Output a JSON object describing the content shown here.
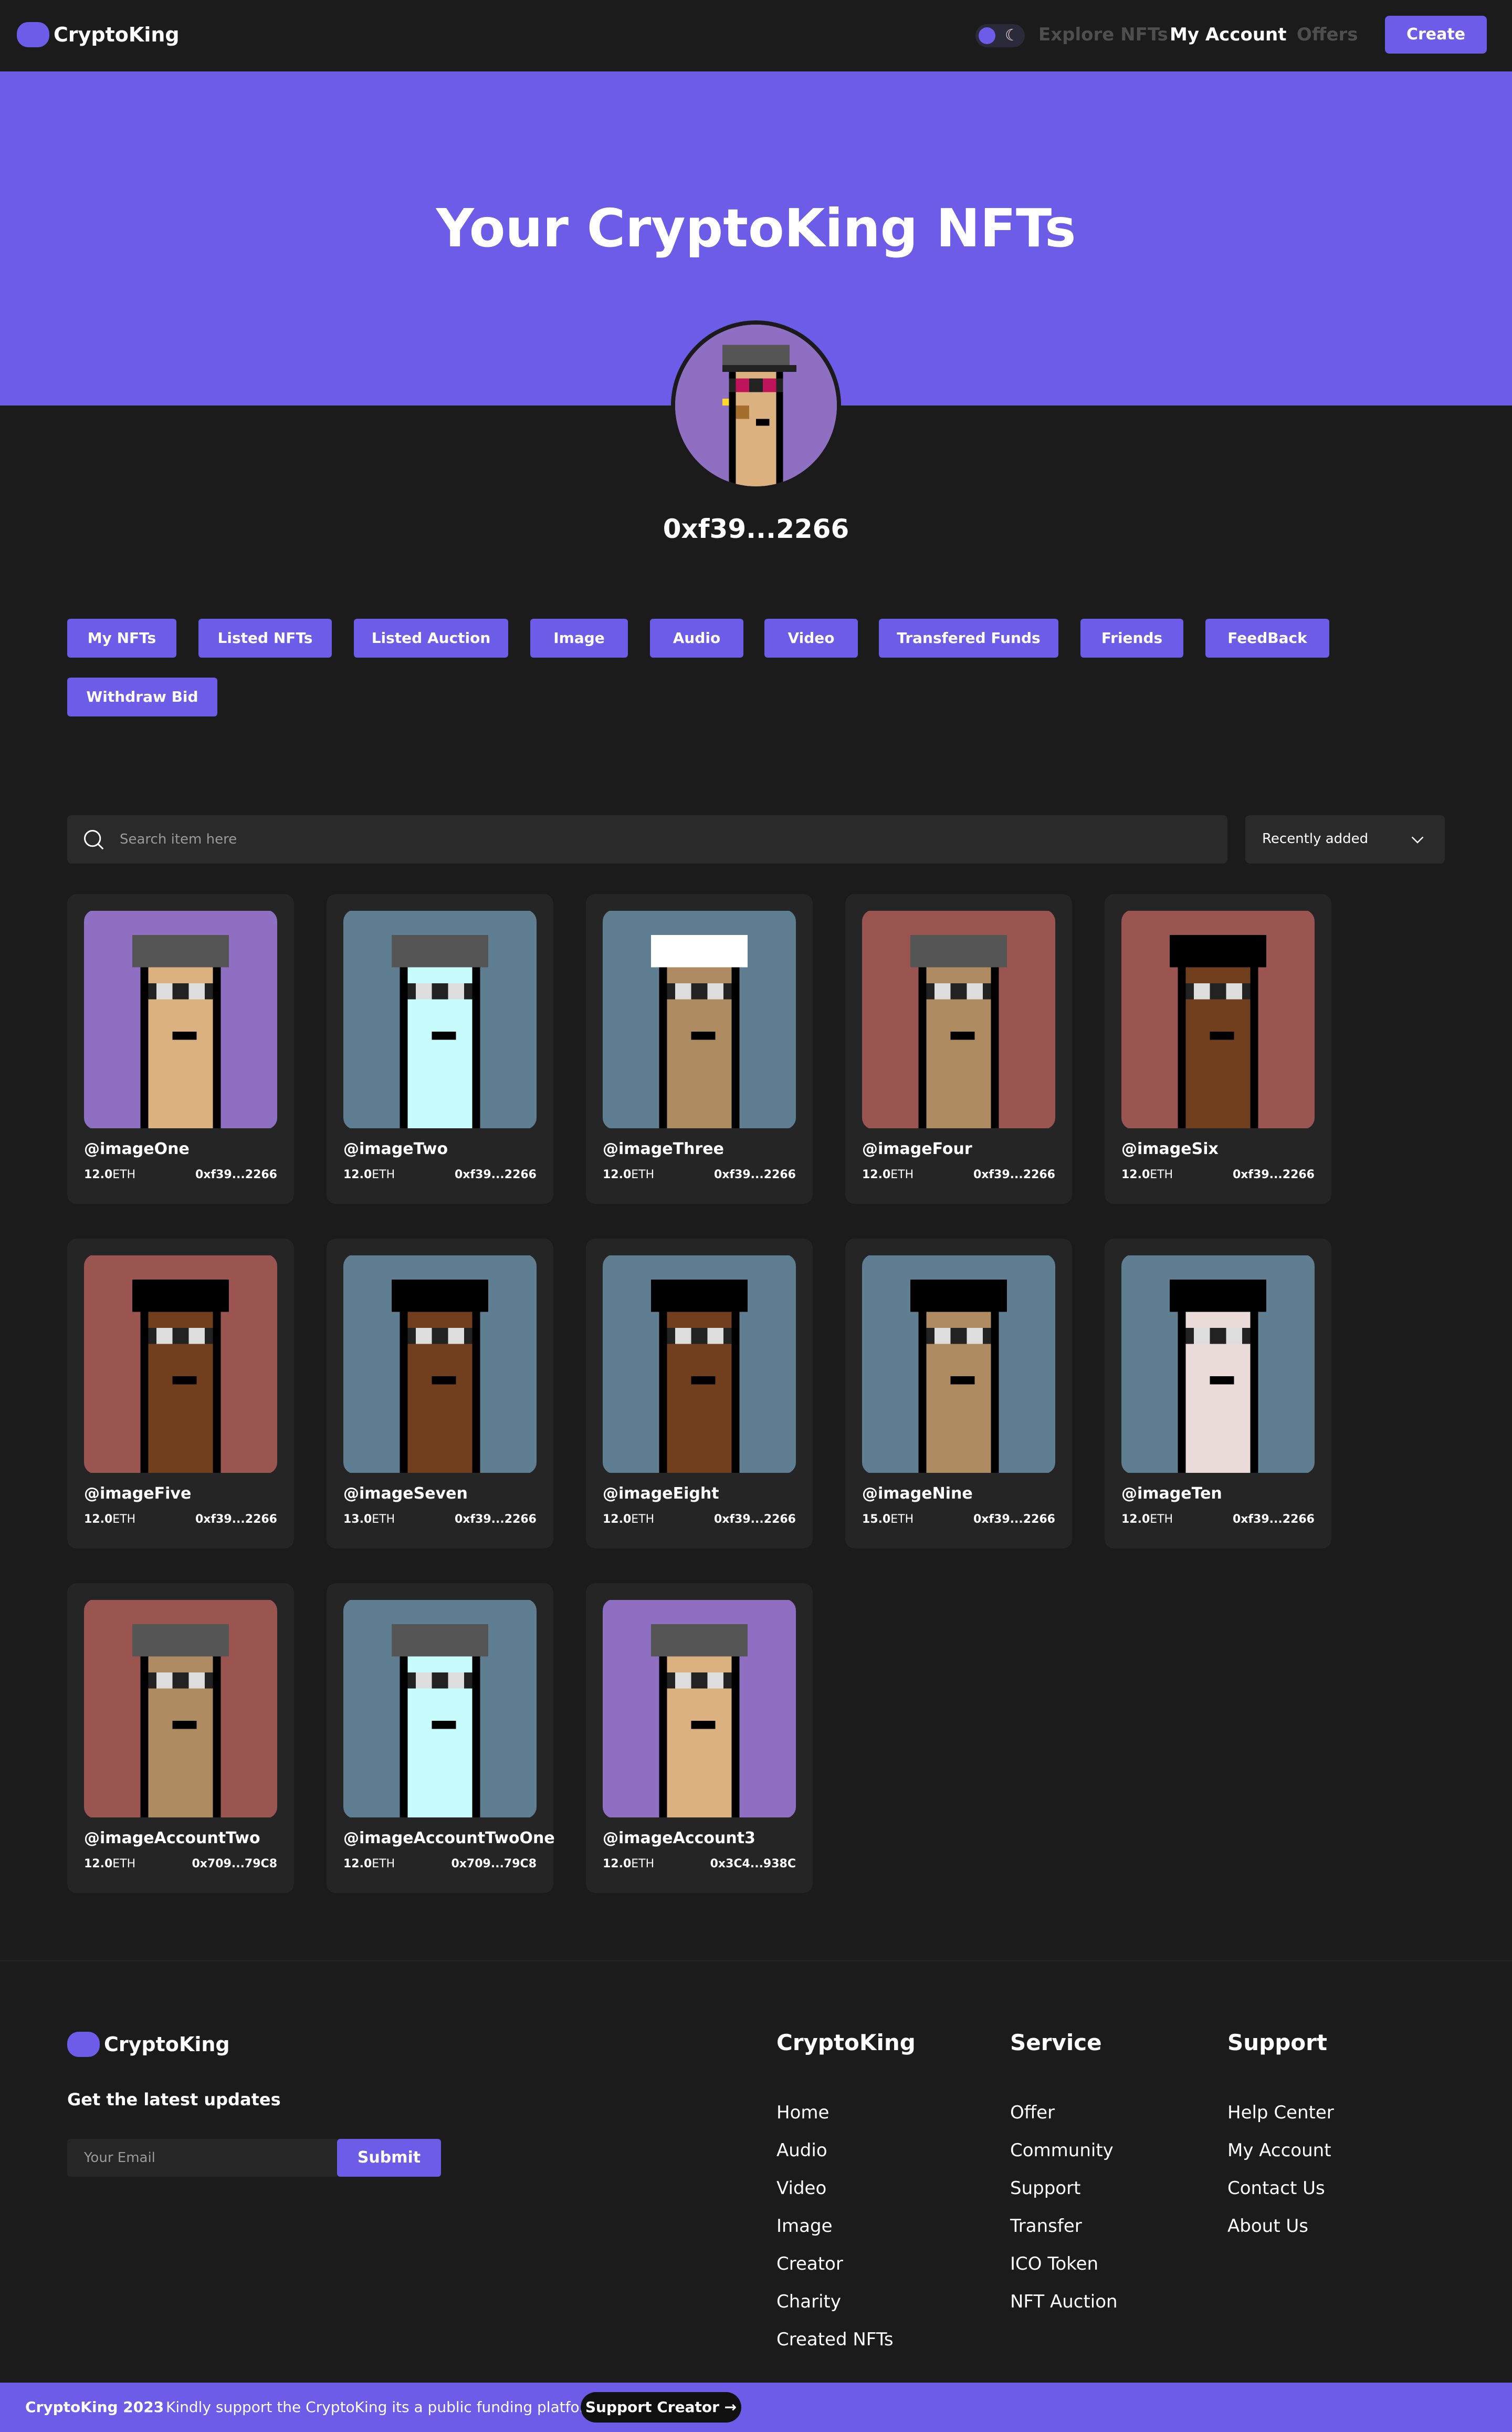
{
  "nav": {
    "logo": "CryptoKing",
    "links": [
      "Explore NFTs",
      "My Account",
      "Offers"
    ],
    "create_label": "Create"
  },
  "hero": {
    "title": "Your CryptoKing NFTs",
    "wallet": "0xf39...2266"
  },
  "tabs": [
    "My NFTs",
    "Listed NFTs",
    "Listed Auction",
    "Image",
    "Audio",
    "Video",
    "Transfered Funds",
    "Friends",
    "FeedBack",
    "Withdraw Bid"
  ],
  "search": {
    "placeholder": "Search item here",
    "sort_label": "Recently added"
  },
  "nfts": [
    {
      "name": "@imageOne",
      "price": "12.0",
      "unit": "ETH",
      "owner": "0xf39...2266",
      "bg": "#8e6fc1"
    },
    {
      "name": "@imageTwo",
      "price": "12.0",
      "unit": "ETH",
      "owner": "0xf39...2266",
      "bg": "#5f7e91"
    },
    {
      "name": "@imageThree",
      "price": "12.0",
      "unit": "ETH",
      "owner": "0xf39...2266",
      "bg": "#5f7e91"
    },
    {
      "name": "@imageFour",
      "price": "12.0",
      "unit": "ETH",
      "owner": "0xf39...2266",
      "bg": "#9a5550"
    },
    {
      "name": "@imageSix",
      "price": "12.0",
      "unit": "ETH",
      "owner": "0xf39...2266",
      "bg": "#9a5550"
    },
    {
      "name": "@imageFive",
      "price": "12.0",
      "unit": "ETH",
      "owner": "0xf39...2266",
      "bg": "#9a5550"
    },
    {
      "name": "@imageSeven",
      "price": "13.0",
      "unit": "ETH",
      "owner": "0xf39...2266",
      "bg": "#5f7e91"
    },
    {
      "name": "@imageEight",
      "price": "12.0",
      "unit": "ETH",
      "owner": "0xf39...2266",
      "bg": "#5f7e91"
    },
    {
      "name": "@imageNine",
      "price": "15.0",
      "unit": "ETH",
      "owner": "0xf39...2266",
      "bg": "#5f7e91"
    },
    {
      "name": "@imageTen",
      "price": "12.0",
      "unit": "ETH",
      "owner": "0xf39...2266",
      "bg": "#5f7e91"
    },
    {
      "name": "@imageAccountTwo",
      "price": "12.0",
      "unit": "ETH",
      "owner": "0x709...79C8",
      "bg": "#9a5550"
    },
    {
      "name": "@imageAccountTwoOne",
      "price": "12.0",
      "unit": "ETH",
      "owner": "0x709...79C8",
      "bg": "#5f7e91"
    },
    {
      "name": "@imageAccount3",
      "price": "12.0",
      "unit": "ETH",
      "owner": "0x3C4...938C",
      "bg": "#8e6fc1"
    }
  ],
  "footer": {
    "logo": "CryptoKing",
    "updates_title": "Get the latest updates",
    "email_placeholder": "Your Email",
    "submit_label": "Submit",
    "columns": [
      {
        "title": "CryptoKing",
        "links": [
          "Home",
          "Audio",
          "Video",
          "Image",
          "Creator",
          "Charity",
          "Created NFTs"
        ]
      },
      {
        "title": "Service",
        "links": [
          "Offer",
          "Community",
          "Support",
          "Transfer",
          "ICO Token",
          "NFT Auction"
        ]
      },
      {
        "title": "Support",
        "links": [
          "Help Center",
          "My Account",
          "Contact Us",
          "About Us"
        ]
      }
    ]
  },
  "bottom_bar": {
    "copyright": "CryptoKing 2023",
    "separator": "·",
    "message": "Kindly support the CryptoKing its a public funding platform",
    "button_label": "Support Creator →"
  },
  "colors": {
    "accent": "#6c5ce7",
    "background": "#1b1b1b",
    "card": "#252525"
  }
}
